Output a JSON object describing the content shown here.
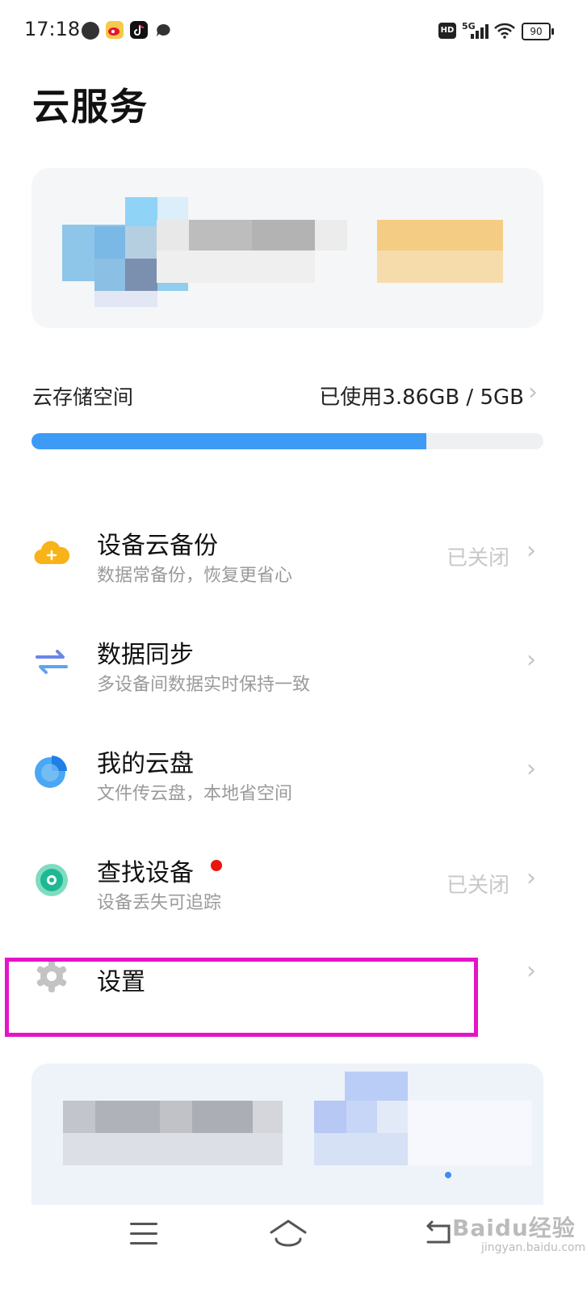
{
  "status_bar": {
    "time": "17:18",
    "network_badge": "HD",
    "network_type": "5G",
    "battery": "90",
    "notification_icons": [
      "music-app-icon",
      "weibo-icon",
      "tiktok-icon",
      "message-icon"
    ],
    "system_icons": [
      "hd-icon",
      "signal-icon",
      "wifi-icon",
      "battery-icon"
    ]
  },
  "page": {
    "title": "云服务"
  },
  "storage": {
    "label": "云存储空间",
    "used_text": "已使用3.86GB / 5GB",
    "used_fraction": 0.772,
    "bar_color": "#3d9bf6"
  },
  "menu": {
    "items": [
      {
        "title": "设备云备份",
        "subtitle": "数据常备份，恢复更省心",
        "status": "已关闭",
        "icon": "cloud-backup-icon"
      },
      {
        "title": "数据同步",
        "subtitle": "多设备间数据实时保持一致",
        "status": "",
        "icon": "sync-arrows-icon"
      },
      {
        "title": "我的云盘",
        "subtitle": "文件传云盘，本地省空间",
        "status": "",
        "icon": "cloud-drive-icon"
      },
      {
        "title": "查找设备",
        "subtitle": "设备丢失可追踪",
        "status": "已关闭",
        "icon": "find-device-icon"
      },
      {
        "title": "设置",
        "subtitle": "",
        "status": "",
        "icon": "gear-icon"
      }
    ]
  },
  "navbar": {
    "icons": [
      "menu-icon",
      "home-icon",
      "back-icon"
    ]
  },
  "watermark": {
    "text": "Baidu经验",
    "subtext": "jingyan.baidu.com"
  }
}
